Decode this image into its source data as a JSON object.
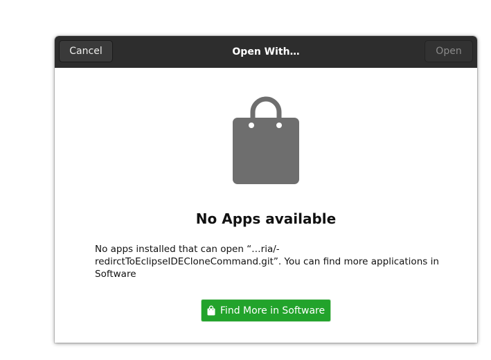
{
  "dialog": {
    "title": "Open With…",
    "cancel_label": "Cancel",
    "open_label": "Open",
    "heading": "No Apps available",
    "message": "No apps installed that can open “…ria/-redirctToEclipseIDECloneCommand.git”. You can find more applications in Software",
    "find_button_label": "Find More in Software",
    "find_button_icon": "shopping-bag-icon",
    "main_icon": "shopping-bag-icon",
    "open_enabled": false
  },
  "colors": {
    "header_bg": "#2d2d2d",
    "accent_green": "#22a32b",
    "icon_gray": "#6e6e6e"
  }
}
